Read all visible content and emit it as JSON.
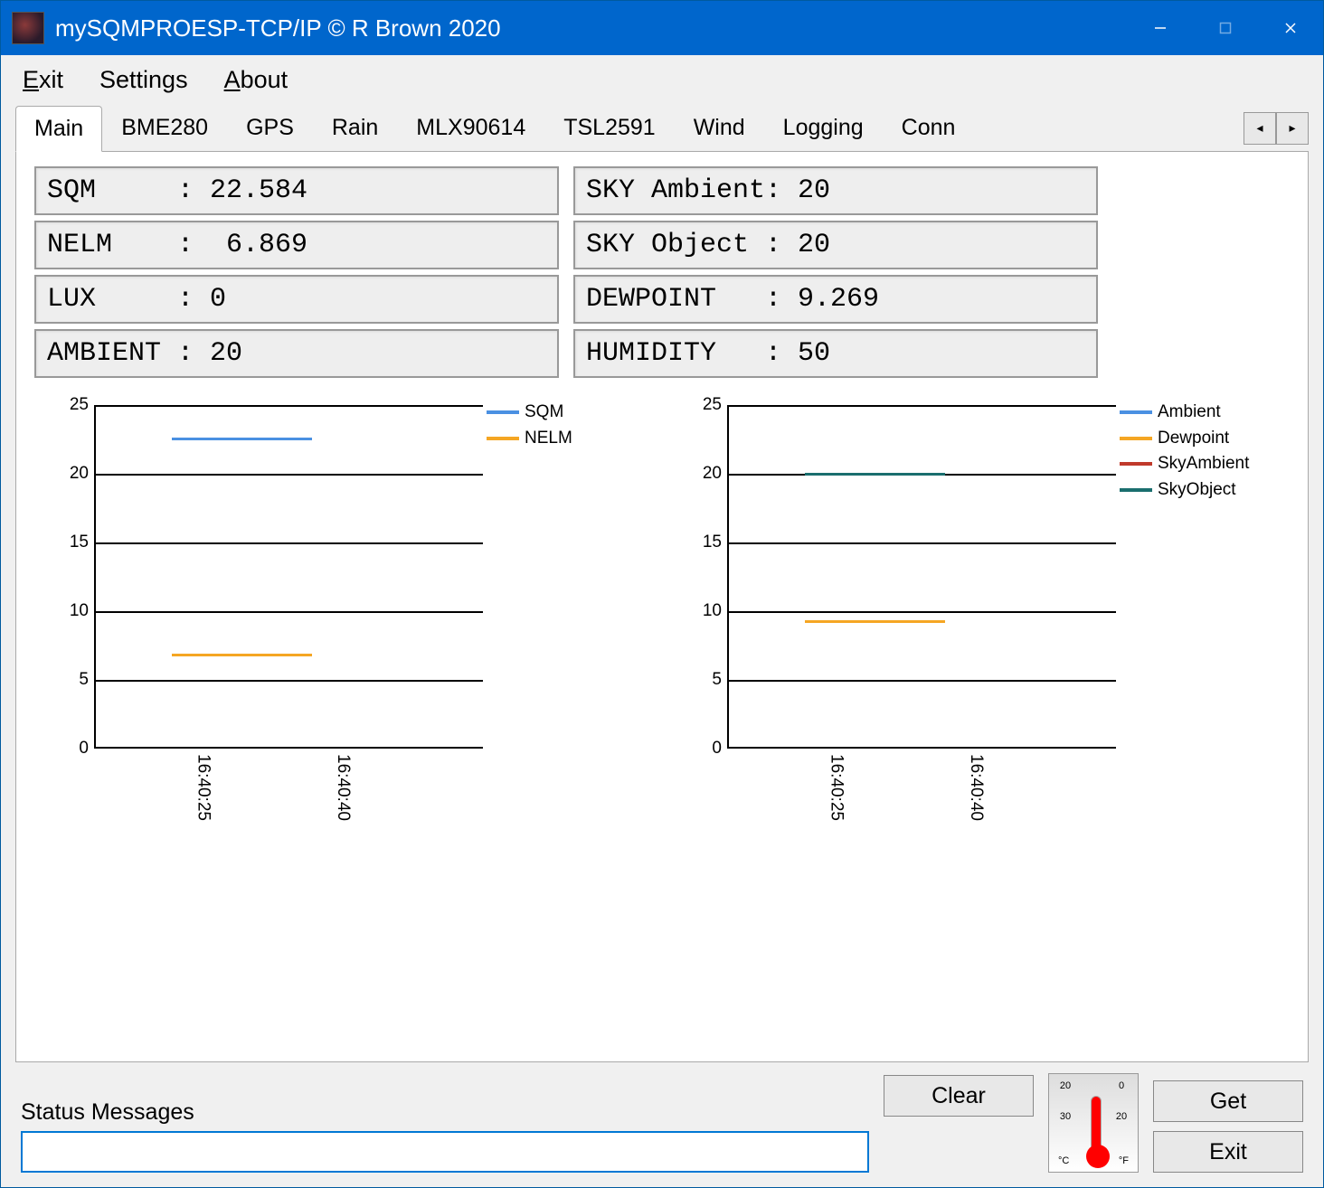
{
  "window": {
    "title": "mySQMPROESP-TCP/IP © R Brown 2020"
  },
  "menu": {
    "exit": "Exit",
    "settings": "Settings",
    "about": "About"
  },
  "tabs": [
    "Main",
    "BME280",
    "GPS",
    "Rain",
    "MLX90614",
    "TSL2591",
    "Wind",
    "Logging",
    "Conn"
  ],
  "readouts_left": [
    {
      "label": "SQM",
      "value": "22.584",
      "text": "SQM     : 22.584"
    },
    {
      "label": "NELM",
      "value": "6.869",
      "text": "NELM    :  6.869"
    },
    {
      "label": "LUX",
      "value": "0",
      "text": "LUX     : 0"
    },
    {
      "label": "AMBIENT",
      "value": "20",
      "text": "AMBIENT : 20"
    }
  ],
  "readouts_right": [
    {
      "label": "SKY Ambient",
      "value": "20",
      "text": "SKY Ambient: 20"
    },
    {
      "label": "SKY Object",
      "value": "20",
      "text": "SKY Object : 20"
    },
    {
      "label": "DEWPOINT",
      "value": "9.269",
      "text": "DEWPOINT   : 9.269"
    },
    {
      "label": "HUMIDITY",
      "value": "50",
      "text": "HUMIDITY   : 50"
    }
  ],
  "status_label": "Status Messages",
  "buttons": {
    "clear": "Clear",
    "get": "Get",
    "exit": "Exit"
  },
  "thermometer": {
    "left_scale": [
      "20",
      "30"
    ],
    "right_scale": [
      "0",
      "20"
    ],
    "left_unit": "°C",
    "right_unit": "°F"
  },
  "chart_data": [
    {
      "type": "line",
      "title": "",
      "xlabel": "",
      "ylabel": "",
      "ylim": [
        0,
        25
      ],
      "yticks": [
        0,
        5,
        10,
        15,
        20,
        25
      ],
      "x": [
        "16:40:25",
        "16:40:40"
      ],
      "series": [
        {
          "name": "SQM",
          "color": "#4A90E2",
          "values": [
            22.584,
            22.584
          ]
        },
        {
          "name": "NELM",
          "color": "#F5A623",
          "values": [
            6.869,
            6.869
          ]
        }
      ]
    },
    {
      "type": "line",
      "title": "",
      "xlabel": "",
      "ylabel": "",
      "ylim": [
        0,
        25
      ],
      "yticks": [
        0,
        5,
        10,
        15,
        20,
        25
      ],
      "x": [
        "16:40:25",
        "16:40:40"
      ],
      "series": [
        {
          "name": "Ambient",
          "color": "#4A90E2",
          "values": [
            20,
            20
          ]
        },
        {
          "name": "Dewpoint",
          "color": "#F5A623",
          "values": [
            9.269,
            9.269
          ]
        },
        {
          "name": "SkyAmbient",
          "color": "#C0392B",
          "values": [
            20,
            20
          ]
        },
        {
          "name": "SkyObject",
          "color": "#1A6E6E",
          "values": [
            20,
            20
          ]
        }
      ]
    }
  ]
}
